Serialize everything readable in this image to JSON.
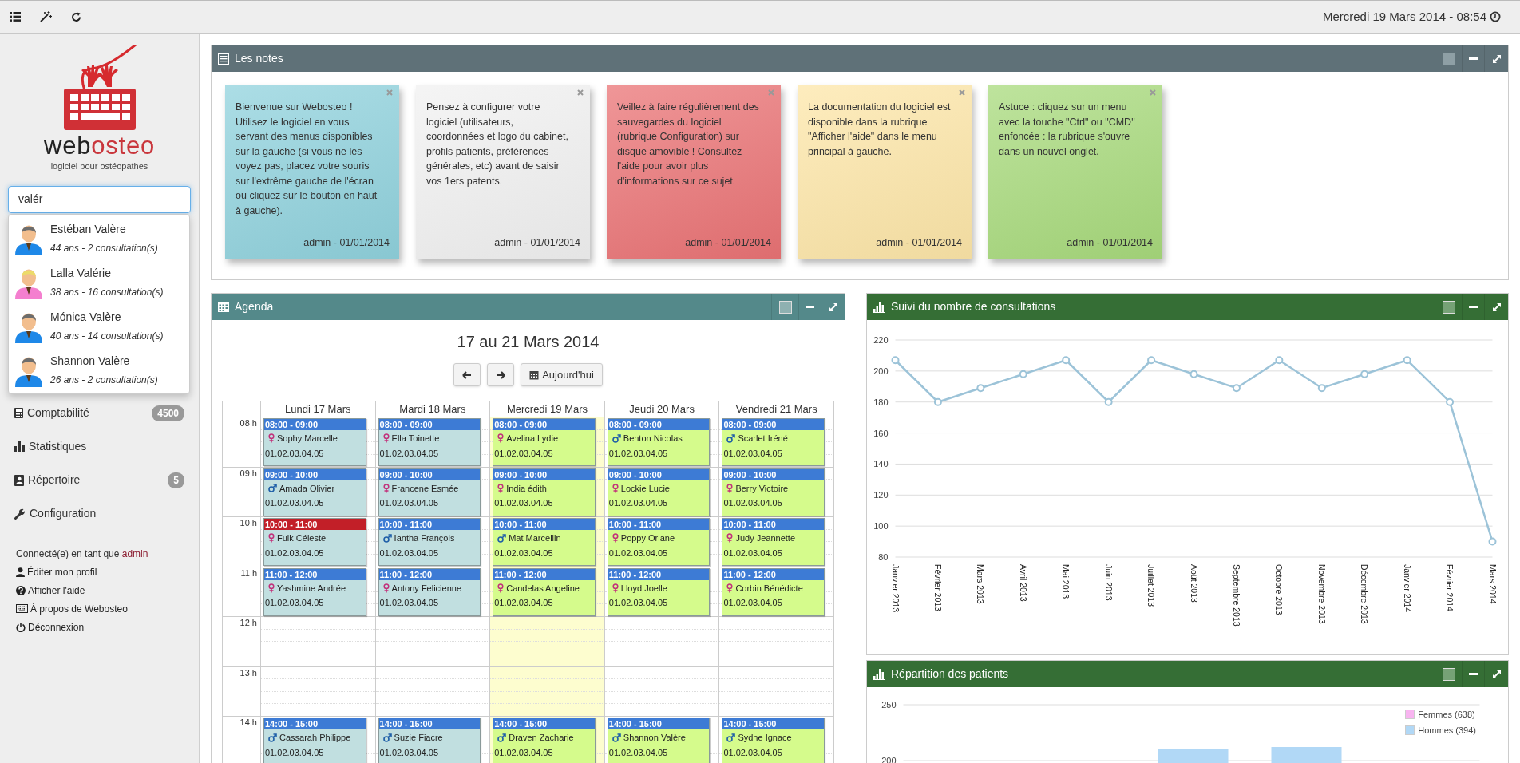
{
  "topbar": {
    "datetime": "Mercredi 19 Mars 2014 - 08:54"
  },
  "sidebar": {
    "logo": {
      "word_parts": [
        "web",
        "osteo"
      ],
      "tagline": "logiciel pour ostéopathes"
    },
    "search": {
      "value": "valér"
    },
    "suggestions": [
      {
        "name": "Estéban Valère",
        "details": "44 ans - 2 consultation(s)",
        "kind": "male"
      },
      {
        "name": "Lalla Valérie",
        "details": "38 ans - 16 consultation(s)",
        "kind": "female"
      },
      {
        "name": "Mónica Valère",
        "details": "40 ans - 14 consultation(s)",
        "kind": "male"
      },
      {
        "name": "Shannon Valère",
        "details": "26 ans - 2 consultation(s)",
        "kind": "male"
      }
    ],
    "menu": [
      {
        "label": "Comptabilité",
        "badge": "4500"
      },
      {
        "label": "Statistiques"
      },
      {
        "label": "Répertoire",
        "badge": "5"
      },
      {
        "label": "Configuration"
      }
    ],
    "session": {
      "prefix": "Connecté(e) en tant que",
      "user": "admin"
    },
    "links": [
      "Éditer mon profil",
      "Afficher l'aide",
      "À propos de Webosteo",
      "Déconnexion"
    ]
  },
  "notes_panel": {
    "title": "Les notes",
    "notes": [
      {
        "text": "Bienvenue sur Webosteo ! Utilisez le logiciel en vous servant des menus disponibles sur la gauche (si vous ne les voyez pas, placez votre souris sur l'extrême gauche de l'écran ou cliquez sur le bouton en haut à gauche).",
        "footer": "admin - 01/01/2014",
        "color": "#90d2dd"
      },
      {
        "text": "Pensez à configurer votre logiciel (utilisateurs, coordonnées et logo du cabinet, profils patients, préférences générales, etc) avant de saisir vos 1ers patents.",
        "footer": "admin - 01/01/2014",
        "color": "#f1f1f1"
      },
      {
        "text": "Veillez à faire régulièrement des sauvegardes du logiciel (rubrique Configuration) sur disque amovible ! Consultez l'aide pour avoir plus d'informations sur ce sujet.",
        "footer": "admin - 01/01/2014",
        "color": "#ea7375"
      },
      {
        "text": "La documentation du logiciel est disponible dans la rubrique \"Afficher l'aide\" dans le menu principal à gauche.",
        "footer": "admin - 01/01/2014",
        "color": "#fde6a8"
      },
      {
        "text": "Astuce : cliquez sur un menu avec la touche \"Ctrl\" ou \"CMD\" enfoncée : la rubrique s'ouvre dans un nouvel onglet.",
        "footer": "admin - 01/01/2014",
        "color": "#a8da7c"
      }
    ]
  },
  "agenda": {
    "title": "Agenda",
    "range": "17 au 21 Mars 2014",
    "today_button": "Aujourd'hui",
    "days": [
      {
        "label": "Lundi 17 Mars",
        "past": true,
        "today": false
      },
      {
        "label": "Mardi 18 Mars",
        "past": true,
        "today": false
      },
      {
        "label": "Mercredi 19 Mars",
        "past": false,
        "today": true
      },
      {
        "label": "Jeudi 20 Mars",
        "past": false,
        "today": false
      },
      {
        "label": "Vendredi 21 Mars",
        "past": false,
        "today": false
      }
    ],
    "rows": [
      {
        "hour": "08 h",
        "events": [
          {
            "time": "08:00 - 09:00",
            "kind": "female",
            "name": "Sophy Marcelle",
            "phone": "01.02.03.04.05",
            "highlighted": false
          },
          {
            "time": "08:00 - 09:00",
            "kind": "female",
            "name": "Ella Toinette",
            "phone": "01.02.03.04.05",
            "highlighted": false
          },
          {
            "time": "08:00 - 09:00",
            "kind": "female",
            "name": "Avelina Lydie",
            "phone": "01.02.03.04.05",
            "highlighted": false
          },
          {
            "time": "08:00 - 09:00",
            "kind": "male",
            "name": "Benton Nicolas",
            "phone": "01.02.03.04.05",
            "highlighted": false
          },
          {
            "time": "08:00 - 09:00",
            "kind": "male",
            "name": "Scarlet Iréné",
            "phone": "01.02.03.04.05",
            "highlighted": false
          }
        ]
      },
      {
        "hour": "09 h",
        "events": [
          {
            "time": "09:00 - 10:00",
            "kind": "male",
            "name": "Amada Olivier",
            "phone": "01.02.03.04.05",
            "highlighted": false
          },
          {
            "time": "09:00 - 10:00",
            "kind": "female",
            "name": "Francene Esmée",
            "phone": "01.02.03.04.05",
            "highlighted": false
          },
          {
            "time": "09:00 - 10:00",
            "kind": "female",
            "name": "India édith",
            "phone": "01.02.03.04.05",
            "highlighted": false
          },
          {
            "time": "09:00 - 10:00",
            "kind": "female",
            "name": "Lockie Lucie",
            "phone": "01.02.03.04.05",
            "highlighted": false
          },
          {
            "time": "09:00 - 10:00",
            "kind": "female",
            "name": "Berry Victoire",
            "phone": "01.02.03.04.05",
            "highlighted": false
          }
        ]
      },
      {
        "hour": "10 h",
        "events": [
          {
            "time": "10:00 - 11:00",
            "kind": "female",
            "name": "Fulk Céleste",
            "phone": "01.02.03.04.05",
            "highlighted": true
          },
          {
            "time": "10:00 - 11:00",
            "kind": "male",
            "name": "Iantha François",
            "phone": "01.02.03.04.05",
            "highlighted": false
          },
          {
            "time": "10:00 - 11:00",
            "kind": "male",
            "name": "Mat Marcellin",
            "phone": "01.02.03.04.05",
            "highlighted": false
          },
          {
            "time": "10:00 - 11:00",
            "kind": "female",
            "name": "Poppy Oriane",
            "phone": "01.02.03.04.05",
            "highlighted": false
          },
          {
            "time": "10:00 - 11:00",
            "kind": "female",
            "name": "Judy Jeannette",
            "phone": "01.02.03.04.05",
            "highlighted": false
          }
        ]
      },
      {
        "hour": "11 h",
        "events": [
          {
            "time": "11:00 - 12:00",
            "kind": "female",
            "name": "Yashmine Andrée",
            "phone": "01.02.03.04.05",
            "highlighted": false
          },
          {
            "time": "11:00 - 12:00",
            "kind": "female",
            "name": "Antony Felicienne",
            "phone": "01.02.03.04.05",
            "highlighted": false
          },
          {
            "time": "11:00 - 12:00",
            "kind": "female",
            "name": "Candelas Angeline",
            "phone": "01.02.03.04.05",
            "highlighted": false
          },
          {
            "time": "11:00 - 12:00",
            "kind": "female",
            "name": "Lloyd Joelle",
            "phone": "01.02.03.04.05",
            "highlighted": false
          },
          {
            "time": "11:00 - 12:00",
            "kind": "female",
            "name": "Corbin Bénédicte",
            "phone": "01.02.03.04.05",
            "highlighted": false
          }
        ]
      },
      {
        "hour": "12 h"
      },
      {
        "hour": "13 h"
      },
      {
        "hour": "14 h",
        "events": [
          {
            "time": "14:00 - 15:00",
            "kind": "male",
            "name": "Cassarah Philippe",
            "phone": "01.02.03.04.05",
            "highlighted": false
          },
          {
            "time": "14:00 - 15:00",
            "kind": "male",
            "name": "Suzie Fiacre",
            "phone": "01.02.03.04.05",
            "highlighted": false
          },
          {
            "time": "14:00 - 15:00",
            "kind": "male",
            "name": "Draven Zacharie",
            "phone": "01.02.03.04.05",
            "highlighted": false
          },
          {
            "time": "14:00 - 15:00",
            "kind": "male",
            "name": "Shannon Valère",
            "phone": "01.02.03.04.05",
            "highlighted": false
          },
          {
            "time": "14:00 - 15:00",
            "kind": "male",
            "name": "Sydne Ignace",
            "phone": "01.02.03.04.05",
            "highlighted": false
          }
        ]
      }
    ]
  },
  "consultations_chart": {
    "title": "Suivi du nombre de consultations",
    "chart_data": {
      "type": "line",
      "categories": [
        "Janvier 2013",
        "Février 2013",
        "Mars 2013",
        "Avril 2013",
        "Mai 2013",
        "Juin 2013",
        "Juillet 2013",
        "Août 2013",
        "Septembre 2013",
        "Octobre 2013",
        "Novembre 2013",
        "Décembre 2013",
        "Janvier 2014",
        "Février 2014",
        "Mars 2014"
      ],
      "series": [
        {
          "color": "#9cc3d8",
          "marker": "circle",
          "values": [
            207,
            180,
            189,
            198,
            207,
            180,
            207,
            198,
            189,
            207,
            189,
            198,
            207,
            180,
            90
          ]
        }
      ],
      "ylim": [
        80,
        220
      ],
      "grid": true,
      "yticks": [
        80,
        100,
        120,
        140,
        160,
        180,
        200,
        220
      ]
    }
  },
  "patients_chart": {
    "title": "Répartition des patients",
    "y_tick_labels": [
      "250",
      "200"
    ],
    "legend": [
      {
        "label": "Femmes (638)",
        "color": "#f8b4f0"
      },
      {
        "label": "Hommes (394)",
        "color": "#b1d8f6"
      }
    ]
  }
}
